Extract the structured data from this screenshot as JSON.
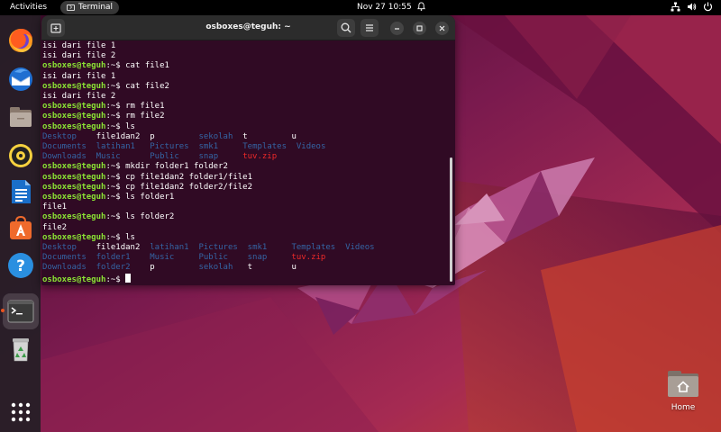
{
  "topbar": {
    "activities": "Activities",
    "app_name": "Terminal",
    "clock": "Nov 27  10:55",
    "icons": [
      "bell-icon",
      "network-icon",
      "volume-icon",
      "power-icon"
    ]
  },
  "dock": {
    "items": [
      {
        "name": "Firefox",
        "icon": "firefox-icon"
      },
      {
        "name": "Thunderbird Mail",
        "icon": "thunderbird-icon"
      },
      {
        "name": "Files",
        "icon": "files-icon"
      },
      {
        "name": "Rhythmbox",
        "icon": "rhythmbox-icon"
      },
      {
        "name": "LibreOffice Writer",
        "icon": "writer-icon"
      },
      {
        "name": "Ubuntu Software",
        "icon": "software-icon"
      },
      {
        "name": "Help",
        "icon": "help-icon"
      },
      {
        "name": "Terminal",
        "icon": "terminal-icon",
        "active": true
      },
      {
        "name": "Trash",
        "icon": "trash-icon"
      },
      {
        "name": "Show Applications",
        "icon": "app-grid-icon"
      }
    ]
  },
  "terminal": {
    "title": "osboxes@teguh: ~",
    "prompt": "osboxes@teguh",
    "prompt_suffix": ":~$ ",
    "lines": [
      {
        "type": "out",
        "text": "isi dari file 1"
      },
      {
        "type": "out",
        "text": "isi dari file 2"
      },
      {
        "type": "cmd",
        "text": "cat file1"
      },
      {
        "type": "out",
        "text": "isi dari file 1"
      },
      {
        "type": "cmd",
        "text": "cat file2"
      },
      {
        "type": "out",
        "text": "isi dari file 2"
      },
      {
        "type": "cmd",
        "text": "rm file1"
      },
      {
        "type": "cmd",
        "text": "rm file2"
      },
      {
        "type": "cmd",
        "text": "ls"
      },
      {
        "type": "ls",
        "text": "Desktop    file1dan2  p         sekolah  t         u"
      },
      {
        "type": "ls",
        "text": "Documents  latihan1   Pictures  smk1     Templates  Videos"
      },
      {
        "type": "ls",
        "text": "Downloads  Music      Public    snap     tuv.zip"
      },
      {
        "type": "cmd",
        "text": "mkdir folder1 folder2"
      },
      {
        "type": "cmd",
        "text": "cp file1dan2 folder1/file1"
      },
      {
        "type": "cmd",
        "text": "cp file1dan2 folder2/file2"
      },
      {
        "type": "cmd",
        "text": "ls folder1"
      },
      {
        "type": "out",
        "text": "file1"
      },
      {
        "type": "cmd",
        "text": "ls folder2"
      },
      {
        "type": "out",
        "text": "file2"
      },
      {
        "type": "cmd",
        "text": "ls"
      },
      {
        "type": "ls",
        "text": "Desktop    file1dan2  latihan1  Pictures  smk1     Templates  Videos"
      },
      {
        "type": "ls",
        "text": "Documents  folder1    Music     Public    snap     tuv.zip"
      },
      {
        "type": "ls",
        "text": "Downloads  folder2    p         sekolah   t        u"
      },
      {
        "type": "cmd",
        "text": "",
        "cursor": true
      }
    ],
    "dirs": [
      "Desktop",
      "Documents",
      "Downloads",
      "latihan1",
      "Pictures",
      "Music",
      "Public",
      "snap",
      "sekolah",
      "smk1",
      "Templates",
      "Videos",
      "folder1",
      "folder2"
    ],
    "archives": [
      "tuv.zip"
    ]
  },
  "desktop": {
    "home_label": "Home"
  },
  "colors": {
    "prompt": "#8ae234",
    "directory": "#3465a4",
    "archive": "#ef2929",
    "terminal_bg": "#300a24",
    "accent": "#e95420"
  }
}
